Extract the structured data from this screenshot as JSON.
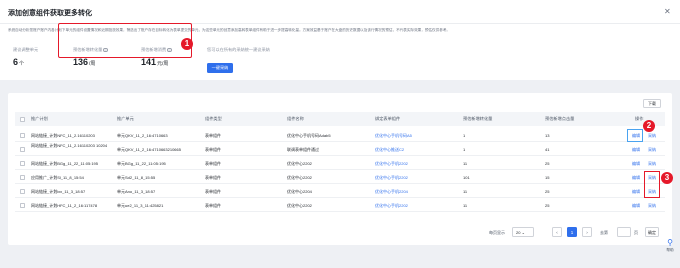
{
  "header": {
    "title": "添加创意组件获取更多转化",
    "close_icon": "close-icon"
  },
  "summary": {
    "description": "系统自动分析您账户账户内各计划下单元的组件设置情况和近期投放效果，筛选出了账户存在目标转化为表单提交的单元，为这些单元的创意添加高转表单组件有助于进一步提高转化量。方案效益基于账户在大盘的历史数据以及该行情况的预估，不代表实际效果，预估仅供参考。",
    "suggest_label": "建议调整单元",
    "suggest_value": "6",
    "suggest_unit": "个",
    "conv_label": "预估新增转化量",
    "conv_value": "136",
    "conv_unit": "/周",
    "cost_label": "预估新增消费",
    "cost_value": "141",
    "cost_unit": "元/周",
    "batch_label": "您可以在所有的采纳统一建议采纳",
    "apply_all_label": "一键采纳"
  },
  "markers": {
    "m1": "1",
    "m2": "2",
    "m3": "3"
  },
  "table": {
    "download_label": "下载",
    "headers": [
      "推广计划",
      "推广单元",
      "组件类型",
      "组件名称",
      "绑定表单组件",
      "预估新增转化量",
      "预估新增点击量",
      "操作"
    ],
    "rows": [
      {
        "plan": "网站链接_计划NFC_11_2.16110203",
        "unit": "单元QKV_11_2_16:4710663",
        "type": "表单组件",
        "name": "优化中心手机号码Adab5",
        "form": "优化中心手机号码A5",
        "conv": "1",
        "click": "13"
      },
      {
        "plan": "网站链接_计划NFC_11_2.16110203 10204",
        "unit": "单元QKV_11_2_16:4710663210665",
        "type": "表单组件",
        "name": "联调表单组件通过",
        "form": "优化中心推送C2",
        "conv": "1",
        "click": "41"
      },
      {
        "plan": "网站链接_计划BGg_11_22_11:05:195",
        "unit": "单元BGg_11_22_11:05:195",
        "type": "表单组件",
        "name": "优化中心2202",
        "form": "优化中心手机2202",
        "conv": "11",
        "click": "25"
      },
      {
        "plan": "应用推广_计划Sl_11_8_15:54",
        "unit": "单元Sd2_11_8_15:55",
        "type": "表单组件",
        "name": "优化中心2202",
        "form": "优化中心手机2202",
        "conv": "101",
        "click": "15"
      },
      {
        "plan": "网站链接_计划lxx_11_3_18:57",
        "unit": "单元Ano_11_3_18:57",
        "type": "表单组件",
        "name": "优化中心2204",
        "form": "优化中心手机2204",
        "conv": "11",
        "click": "25"
      },
      {
        "plan": "网站链接_计划HFC_11_2_16:117478",
        "unit": "单元ue2_11_3_11:425821",
        "type": "表单组件",
        "name": "优化中心2202",
        "form": "优化中心手机2202",
        "conv": "11",
        "click": "25"
      }
    ],
    "op_edit": "编辑",
    "op_apply": "采纳"
  },
  "pagination": {
    "page_size_label": "每页显示",
    "page_size": "20",
    "current_page": "1",
    "goto_label": "去第",
    "page_suffix": "页",
    "confirm_label": "确定"
  },
  "side": {
    "help_label": "帮助"
  }
}
